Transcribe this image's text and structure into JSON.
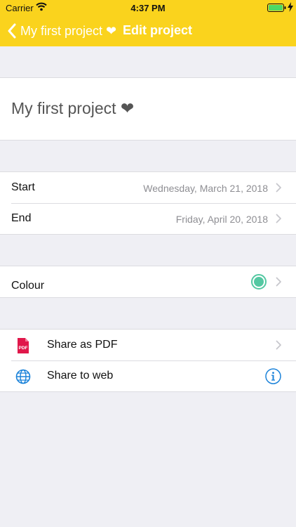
{
  "status_bar": {
    "carrier": "Carrier",
    "time": "4:37 PM"
  },
  "nav": {
    "back_label": "My first project ❤",
    "title": "Edit project"
  },
  "project": {
    "name": "My first project ❤"
  },
  "dates": {
    "start": {
      "label": "Start",
      "value": "Wednesday, March 21, 2018"
    },
    "end": {
      "label": "End",
      "value": "Friday, April 20, 2018"
    }
  },
  "colour": {
    "label": "Colour",
    "swatch": "#54c8a2"
  },
  "share": {
    "pdf": {
      "label": "Share as PDF",
      "icon": "pdf-file-icon",
      "icon_text": "PDF"
    },
    "web": {
      "label": "Share to web",
      "icon": "globe-icon"
    }
  },
  "colors": {
    "nav_background": "#fad31d",
    "pdf_icon": "#e0174a",
    "link_blue": "#1a82d9",
    "background": "#efeff4"
  }
}
